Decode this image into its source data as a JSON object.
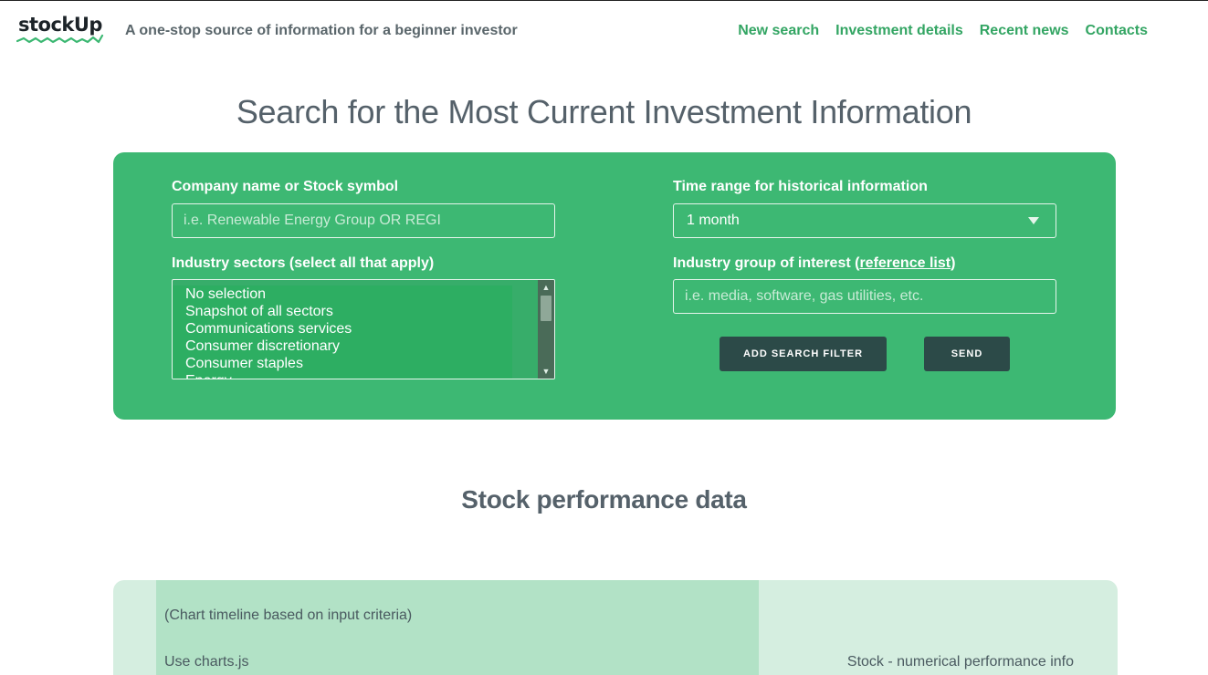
{
  "brand": {
    "logo_text": "stockUp",
    "tagline": "A one-stop source of information for a beginner investor"
  },
  "nav": {
    "items": [
      "New search",
      "Investment details",
      "Recent news",
      "Contacts"
    ]
  },
  "page_title": "Search for the Most Current Investment Information",
  "search": {
    "company_label": "Company name or Stock symbol",
    "company_placeholder": "i.e. Renewable Energy Group OR REGI",
    "time_label": "Time range for historical information",
    "time_value": "1 month",
    "sectors_label": "Industry sectors (select all that apply)",
    "sectors_options": [
      "No selection",
      "Snapshot of all sectors",
      "Communications services",
      "Consumer discretionary",
      "Consumer staples",
      "Energy"
    ],
    "group_label_prefix": "Industry group of interest (",
    "group_label_link": "reference list",
    "group_label_suffix": ")",
    "group_placeholder": "i.e. media, software, gas utilities, etc.",
    "add_filter_label": "ADD SEARCH FILTER",
    "send_label": "SEND"
  },
  "performance": {
    "title": "Stock performance data",
    "chart_note": "(Chart timeline based on input criteria)",
    "chart_lib": "Use charts.js",
    "numeric_info": "Stock - numerical performance info"
  },
  "colors": {
    "accent": "#3db873",
    "nav": "#33a563",
    "button": "#2c4a48"
  }
}
